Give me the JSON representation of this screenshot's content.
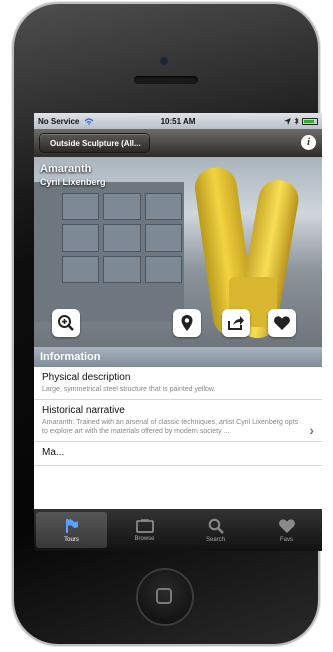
{
  "status": {
    "carrier": "No Service",
    "time": "10:51 AM"
  },
  "nav": {
    "back_label": "Outside Sculpture (All...",
    "info_label": "i"
  },
  "hero": {
    "title": "Amaranth",
    "subtitle": "Cyril Lixenberg"
  },
  "section": {
    "title": "Information"
  },
  "rows": [
    {
      "title": "Physical description",
      "desc": "Large, symmetrical steel structure that is painted yellow."
    },
    {
      "title": "Historical narrative",
      "desc": "Amaranth: Trained with an arsenal of classic techniques, artist Cyril Lixenberg opts to explore art with the materials offered by modern society ..."
    },
    {
      "title": "Ma..."
    }
  ],
  "tabs": [
    {
      "label": "Tours",
      "icon": "flag-icon"
    },
    {
      "label": "Browse",
      "icon": "browse-icon"
    },
    {
      "label": "Search",
      "icon": "search-icon"
    },
    {
      "label": "Favs",
      "icon": "heart-icon"
    }
  ],
  "colors": {
    "navbar": "#3c3a37",
    "section_header": "#8e9aa7",
    "tabbar": "#1a1a1a",
    "sculpture": "#f2d440"
  }
}
